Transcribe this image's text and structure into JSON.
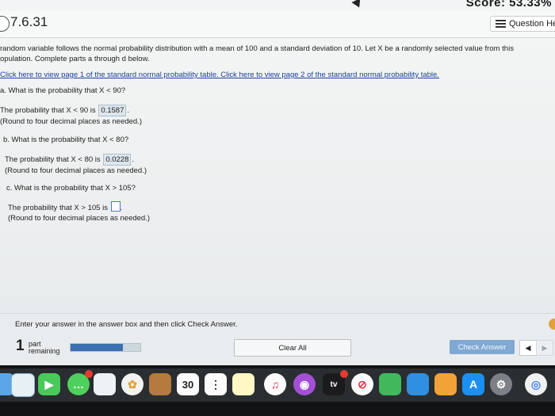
{
  "score": "Score: 53.33%",
  "header": {
    "question_number": "7.6.31",
    "question_help_label": "Question He"
  },
  "problem": {
    "intro_line1": "random variable follows the normal probability distribution with a mean of 100 and a standard deviation of 10. Let X be a randomly selected value from this",
    "intro_line2": "opulation. Complete parts a through d below.",
    "link1": "Click here to view page 1 of the standard normal probability table.",
    "link2": "Click here to view page 2 of the standard normal probability table."
  },
  "parts": {
    "a": {
      "question": "a. What is the probability that X < 90?",
      "answer_prefix": "The probability that X < 90 is",
      "answer_value": "0.1587",
      "answer_suffix": ".",
      "note": "(Round to four decimal places as needed.)"
    },
    "b": {
      "question": "b. What is the probability that X < 80?",
      "answer_prefix": "The probability that X < 80 is",
      "answer_value": "0.0228",
      "answer_suffix": ".",
      "note": "(Round to four decimal places as needed.)"
    },
    "c": {
      "question": "c. What is the probability that X > 105?",
      "answer_prefix": "The probability that X > 105 is",
      "answer_value": "",
      "answer_suffix": ".",
      "note": "(Round to four decimal places as needed.)"
    }
  },
  "footer": {
    "instruction": "Enter your answer in the answer box and then click Check Answer.",
    "remaining_count": "1",
    "remaining_label_1": "part",
    "remaining_label_2": "remaining",
    "progress_fraction": 0.75,
    "clear_all": "Clear All",
    "check_answer": "Check Answer",
    "prev_glyph": "◀",
    "next_glyph": "▶"
  },
  "dock": {
    "calendar_day": "30",
    "apps": [
      "finder-icon",
      "preview-icon",
      "facetime-icon",
      "messages-icon",
      "photos-icon",
      "mail-icon",
      "contacts-icon",
      "calendar-icon",
      "notes-icon",
      "reminders-icon",
      "stickies-icon",
      "music-icon",
      "podcasts-icon",
      "apple-tv-icon",
      "news-icon",
      "numbers-icon",
      "keynote-icon",
      "pages-icon",
      "app-store-icon",
      "system-preferences-icon",
      "chrome-icon"
    ],
    "tv_label": "tv"
  },
  "colors": {
    "link": "#1a3f9e",
    "answer_bg": "#dde6ee",
    "check_button": "#7fa8d2",
    "progress_fill": "#3a6fb1"
  }
}
